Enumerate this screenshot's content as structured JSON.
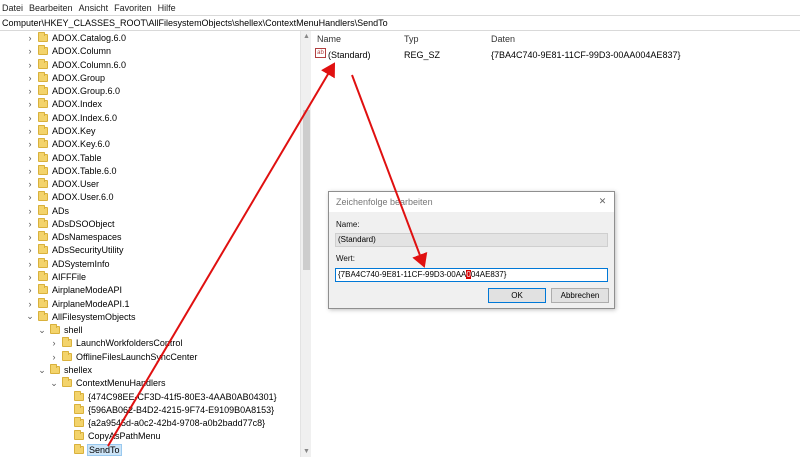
{
  "menu": [
    "Datei",
    "Bearbeiten",
    "Ansicht",
    "Favoriten",
    "Hilfe"
  ],
  "address": "Computer\\HKEY_CLASSES_ROOT\\AllFilesystemObjects\\shellex\\ContextMenuHandlers\\SendTo",
  "tree": [
    {
      "label": "ADOX.Catalog.6.0",
      "level": 0,
      "expander": "right"
    },
    {
      "label": "ADOX.Column",
      "level": 0,
      "expander": "right"
    },
    {
      "label": "ADOX.Column.6.0",
      "level": 0,
      "expander": "right"
    },
    {
      "label": "ADOX.Group",
      "level": 0,
      "expander": "right"
    },
    {
      "label": "ADOX.Group.6.0",
      "level": 0,
      "expander": "right"
    },
    {
      "label": "ADOX.Index",
      "level": 0,
      "expander": "right"
    },
    {
      "label": "ADOX.Index.6.0",
      "level": 0,
      "expander": "right"
    },
    {
      "label": "ADOX.Key",
      "level": 0,
      "expander": "right"
    },
    {
      "label": "ADOX.Key.6.0",
      "level": 0,
      "expander": "right"
    },
    {
      "label": "ADOX.Table",
      "level": 0,
      "expander": "right"
    },
    {
      "label": "ADOX.Table.6.0",
      "level": 0,
      "expander": "right"
    },
    {
      "label": "ADOX.User",
      "level": 0,
      "expander": "right"
    },
    {
      "label": "ADOX.User.6.0",
      "level": 0,
      "expander": "right"
    },
    {
      "label": "ADs",
      "level": 0,
      "expander": "right"
    },
    {
      "label": "ADsDSOObject",
      "level": 0,
      "expander": "right"
    },
    {
      "label": "ADsNamespaces",
      "level": 0,
      "expander": "right"
    },
    {
      "label": "ADsSecurityUtility",
      "level": 0,
      "expander": "right"
    },
    {
      "label": "ADSystemInfo",
      "level": 0,
      "expander": "right"
    },
    {
      "label": "AIFFFile",
      "level": 0,
      "expander": "right"
    },
    {
      "label": "AirplaneModeAPI",
      "level": 0,
      "expander": "right"
    },
    {
      "label": "AirplaneModeAPI.1",
      "level": 0,
      "expander": "right"
    },
    {
      "label": "AllFilesystemObjects",
      "level": 0,
      "expander": "down"
    },
    {
      "label": "shell",
      "level": 1,
      "expander": "down"
    },
    {
      "label": "LaunchWorkfoldersControl",
      "level": 2,
      "expander": "right"
    },
    {
      "label": "OfflineFilesLaunchSyncCenter",
      "level": 2,
      "expander": "right"
    },
    {
      "label": "shellex",
      "level": 1,
      "expander": "down"
    },
    {
      "label": "ContextMenuHandlers",
      "level": 2,
      "expander": "down"
    },
    {
      "label": "{474C98EE-CF3D-41f5-80E3-4AAB0AB04301}",
      "level": 3,
      "expander": "none"
    },
    {
      "label": "{596AB062-B4D2-4215-9F74-E9109B0A8153}",
      "level": 3,
      "expander": "none"
    },
    {
      "label": "{a2a9545d-a0c2-42b4-9708-a0b2badd77c8}",
      "level": 3,
      "expander": "none"
    },
    {
      "label": "CopyAsPathMenu",
      "level": 3,
      "expander": "none"
    },
    {
      "label": "SendTo",
      "level": 3,
      "expander": "none",
      "selected": true
    }
  ],
  "values_header": {
    "name": "Name",
    "type": "Typ",
    "data": "Daten"
  },
  "value_row": {
    "icon": "ab",
    "name": "(Standard)",
    "type": "REG_SZ",
    "data": "{7BA4C740-9E81-11CF-99D3-00AA004AE837}"
  },
  "dialog": {
    "title": "Zeichenfolge bearbeiten",
    "name_label": "Name:",
    "name_value": "(Standard)",
    "value_label": "Wert:",
    "value_prefix": "{7BA4C740-9E81-11CF-99D3-00AA",
    "value_highlight": "0",
    "value_suffix": "04AE837}",
    "ok": "OK",
    "cancel": "Abbrechen",
    "close": "✕"
  },
  "colors": {
    "annotation": "#e01010",
    "selection": "#cce4f7",
    "highlight": "#d40000"
  }
}
